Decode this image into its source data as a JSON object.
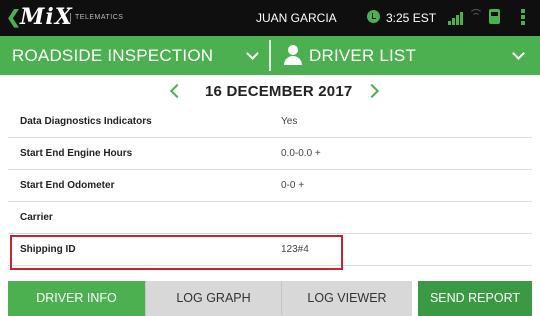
{
  "statusbar": {
    "logo_text": "MiX",
    "logo_subtitle": "TELEMATICS",
    "user_name": "JUAN GARCIA",
    "time": "3:25 EST",
    "icons": [
      "back-chevron-icon",
      "clock-icon",
      "signal-icon",
      "wifi-icon",
      "bus-icon",
      "more-vert-icon"
    ],
    "accent_color": "#4cb050"
  },
  "header": {
    "left_title": "ROADSIDE INSPECTION",
    "right_title": "DRIVER LIST"
  },
  "datebar": {
    "date": "16 DECEMBER 2017"
  },
  "rows": [
    {
      "label": "Data Diagnostics Indicators",
      "value": "Yes"
    },
    {
      "label": "Start End Engine Hours",
      "value": "0.0-0.0 +"
    },
    {
      "label": "Start End Odometer",
      "value": "0-0 +"
    },
    {
      "label": "Carrier",
      "value": ""
    },
    {
      "label": "Shipping ID",
      "value": "123#4"
    }
  ],
  "tabs": {
    "driver_info": "DRIVER INFO",
    "log_graph": "LOG GRAPH",
    "log_viewer": "LOG VIEWER",
    "send_report": "SEND REPORT"
  },
  "highlight_color": "#c0282d"
}
